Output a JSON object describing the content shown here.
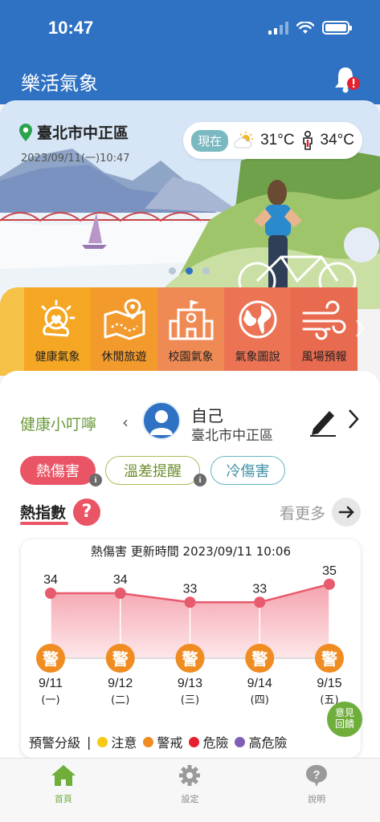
{
  "status_bar": {
    "time": "10:47"
  },
  "header": {
    "title": "樂活氣象"
  },
  "location": {
    "name": "臺北市中正區",
    "datetime": "2023/09/11(一)10:47"
  },
  "weather": {
    "now_label": "現在",
    "temperature": "31°C",
    "apparent_temperature": "34°C"
  },
  "menu": [
    {
      "label": "健康氣象",
      "icon": "health-weather-icon",
      "color": "#f5a623"
    },
    {
      "label": "休閒旅遊",
      "icon": "leisure-map-icon",
      "color": "#f39a2c"
    },
    {
      "label": "校園氣象",
      "icon": "school-icon",
      "color": "#f08a55"
    },
    {
      "label": "氣象圖說",
      "icon": "globe-icon",
      "color": "#ec7455"
    },
    {
      "label": "風場預報",
      "icon": "wind-icon",
      "color": "#e86a4f"
    }
  ],
  "health_tips": {
    "title": "健康小叮嚀",
    "person_name": "自己",
    "person_location": "臺北市中正區"
  },
  "chips": {
    "heat": "熱傷害",
    "temp_diff": "溫差提醒",
    "cold": "冷傷害"
  },
  "heat_index": {
    "label": "熱指數",
    "more": "看更多"
  },
  "chart_data": {
    "type": "line",
    "title": "熱傷害 更新時間 2023/09/11 10:06",
    "categories": [
      "9/11",
      "9/12",
      "9/13",
      "9/14",
      "9/15"
    ],
    "weekdays": [
      "(一)",
      "(二)",
      "(三)",
      "(四)",
      "(五)"
    ],
    "values": [
      34,
      34,
      33,
      33,
      35
    ],
    "levels": [
      "警",
      "警",
      "警",
      "警",
      "警"
    ],
    "level_color": "#ef8c22",
    "line_color": "#e85a6e"
  },
  "legend": {
    "title": "預警分級",
    "items": [
      {
        "label": "注意",
        "color": "#f6c915"
      },
      {
        "label": "警戒",
        "color": "#ef8c22"
      },
      {
        "label": "危險",
        "color": "#e5202e"
      },
      {
        "label": "高危險",
        "color": "#7e5fb5"
      }
    ]
  },
  "feedback": {
    "line1": "意見",
    "line2": "回饋"
  },
  "tabs": [
    {
      "label": "首頁",
      "icon": "home-icon",
      "active": true
    },
    {
      "label": "設定",
      "icon": "gear-icon",
      "active": false
    },
    {
      "label": "說明",
      "icon": "help-icon",
      "active": false
    }
  ]
}
